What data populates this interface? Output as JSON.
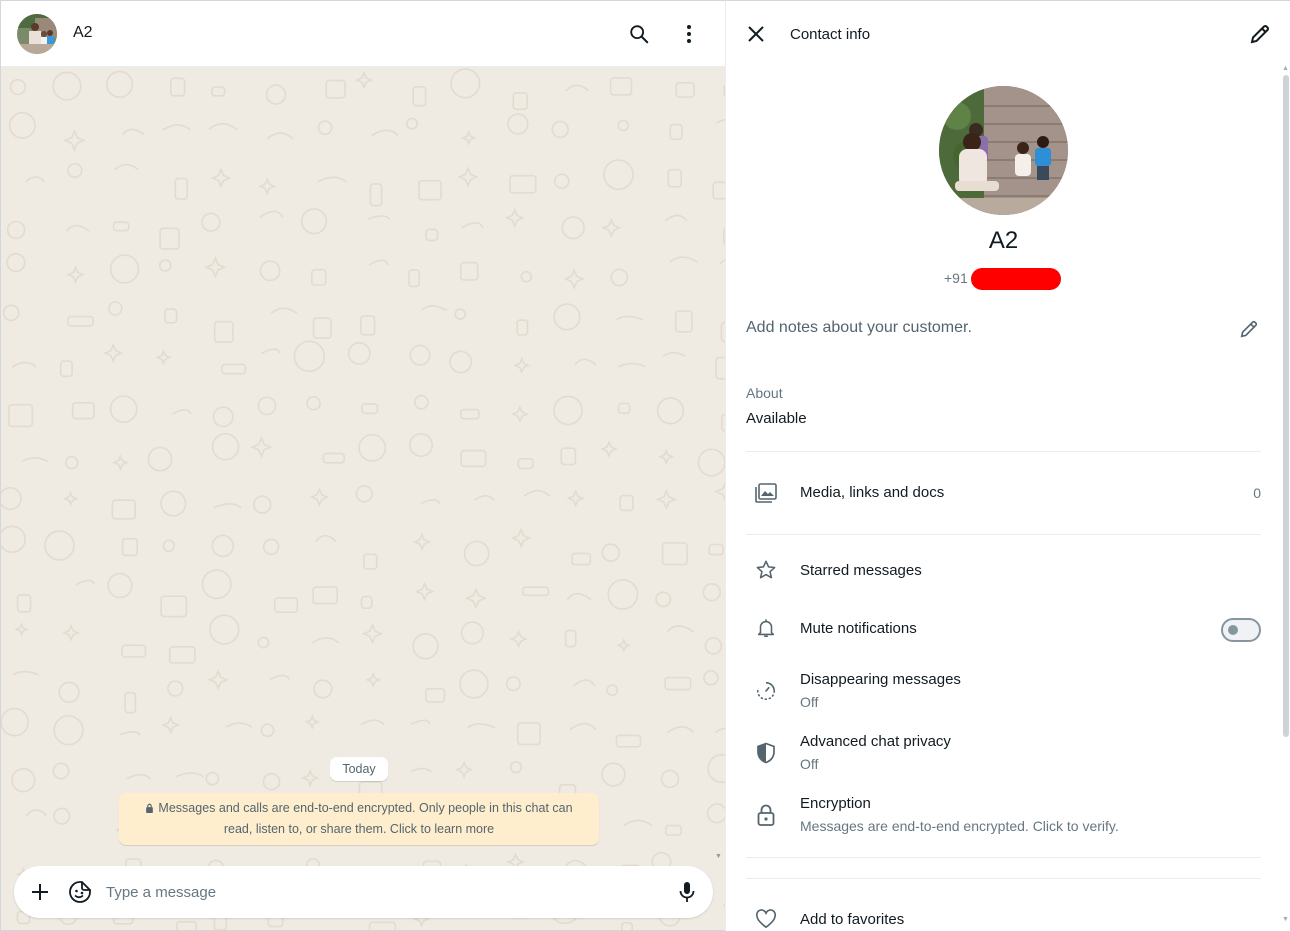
{
  "chat": {
    "title": "A2",
    "day_chip": "Today",
    "encryption_notice": "Messages and calls are end-to-end encrypted. Only people in this chat can read, listen to, or share them. Click to learn more",
    "composer_placeholder": "Type a message"
  },
  "contact_info": {
    "header_title": "Contact info",
    "name": "A2",
    "phone_prefix": "+91",
    "notes_placeholder": "Add notes about your customer.",
    "about_label": "About",
    "about_value": "Available",
    "media": {
      "label": "Media, links and docs",
      "count": "0"
    },
    "starred": {
      "label": "Starred messages"
    },
    "mute": {
      "label": "Mute notifications",
      "enabled": false
    },
    "disappearing": {
      "label": "Disappearing messages",
      "value": "Off"
    },
    "privacy": {
      "label": "Advanced chat privacy",
      "value": "Off"
    },
    "encryption": {
      "label": "Encryption",
      "value": "Messages are end-to-end encrypted. Click to verify."
    },
    "favorites": {
      "label": "Add to favorites"
    }
  },
  "colors": {
    "chat_background": "#efeae2",
    "notice_background": "#ffeecd",
    "redaction": "#ff0000"
  },
  "icons": [
    "search-icon",
    "kebab-menu-icon",
    "close-icon",
    "pencil-icon",
    "plus-icon",
    "sticker-icon",
    "microphone-icon",
    "media-gallery-icon",
    "star-icon",
    "bell-icon",
    "timer-icon",
    "shield-icon",
    "lock-icon",
    "heart-icon"
  ]
}
